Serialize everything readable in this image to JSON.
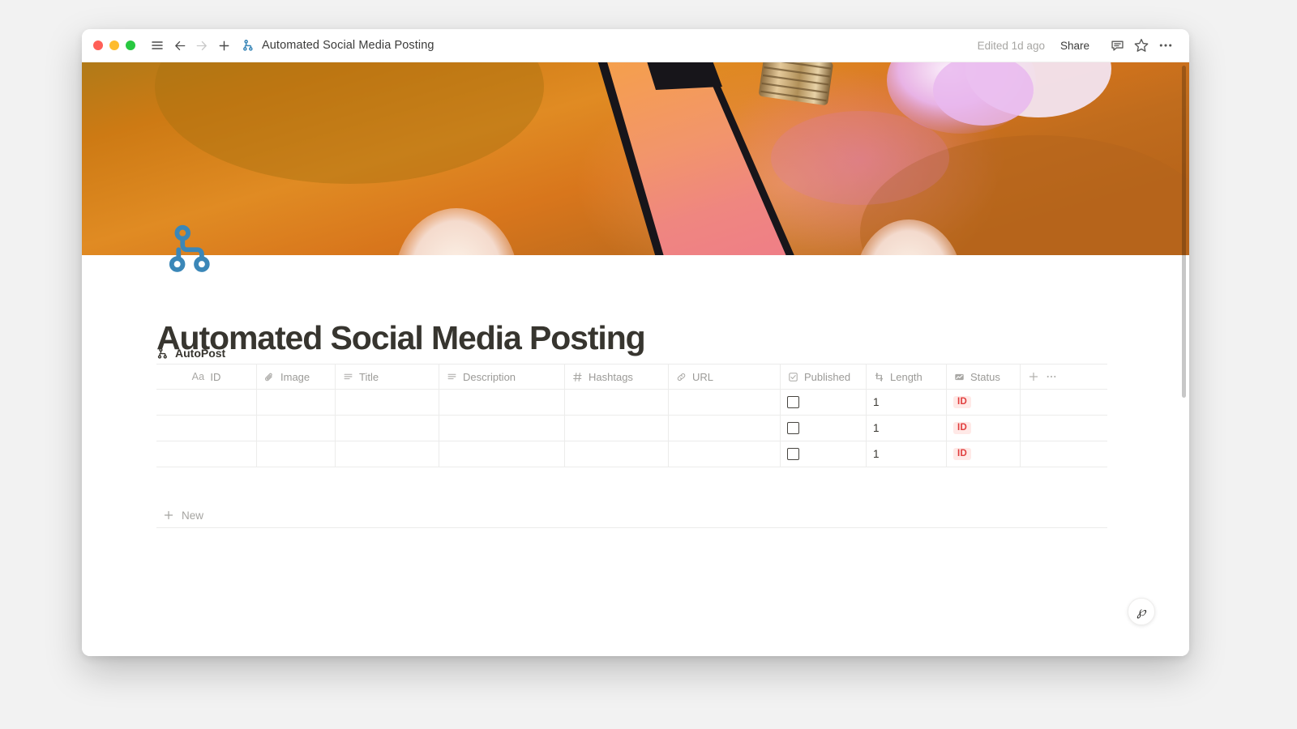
{
  "window": {
    "titlebar": {
      "traffic_lights": [
        {
          "name": "close",
          "color": "#ff5f57"
        },
        {
          "name": "minimize",
          "color": "#febc2e"
        },
        {
          "name": "maximize",
          "color": "#28c840"
        }
      ],
      "sidebar_toggle_icon": "hamburger-menu-icon",
      "back_icon": "arrow-left-icon",
      "forward_icon": "arrow-right-icon",
      "new_page_icon": "plus-icon",
      "doc_icon": "automation-network-icon",
      "doc_title": "Automated Social Media Posting",
      "edited_label": "Edited 1d ago",
      "share_label": "Share",
      "comment_icon": "comment-bubble-icon",
      "favorite_icon": "star-icon",
      "more_icon": "ellipsis-icon"
    }
  },
  "cover": {
    "alt": "Smartphone on orange surface with glowing light bulbs",
    "accent_orange": "#c9711a",
    "accent_pink": "#f2907f",
    "accent_violet": "#e2a8e8"
  },
  "page": {
    "icon": "automation-network-icon",
    "title": "Automated Social Media Posting",
    "database_label": "AutoPost",
    "database_icon": "automation-network-icon"
  },
  "table": {
    "columns": [
      {
        "label": "ID",
        "icon": "title-aa-icon",
        "icon_glyph": "Aa"
      },
      {
        "label": "Image",
        "icon": "paperclip-icon"
      },
      {
        "label": "Title",
        "icon": "text-lines-icon"
      },
      {
        "label": "Description",
        "icon": "text-lines-icon"
      },
      {
        "label": "Hashtags",
        "icon": "hash-icon"
      },
      {
        "label": "URL",
        "icon": "link-icon"
      },
      {
        "label": "Published",
        "icon": "checkbox-icon"
      },
      {
        "label": "Length",
        "icon": "rollup-icon"
      },
      {
        "label": "Status",
        "icon": "formula-chart-icon"
      }
    ],
    "add_column_icon": "plus-icon",
    "column_options_icon": "ellipsis-icon",
    "rows": [
      {
        "id": "",
        "image": "",
        "title": "",
        "description": "",
        "hashtags": "",
        "url": "",
        "published": false,
        "length": "1",
        "status": "ID"
      },
      {
        "id": "",
        "image": "",
        "title": "",
        "description": "",
        "hashtags": "",
        "url": "",
        "published": false,
        "length": "1",
        "status": "ID"
      },
      {
        "id": "",
        "image": "",
        "title": "",
        "description": "",
        "hashtags": "",
        "url": "",
        "published": false,
        "length": "1",
        "status": "ID"
      }
    ],
    "new_row_label": "New",
    "new_row_icon": "plus-icon",
    "status_badge_color": "#e03e3e",
    "status_badge_bg": "#ffe9e7"
  },
  "help_bubble": {
    "icon": "notion-ai-glyph",
    "glyph": "℘"
  }
}
